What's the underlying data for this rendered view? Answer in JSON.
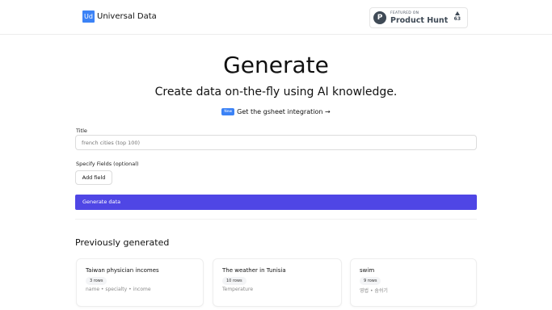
{
  "header": {
    "logo_mark": "Ud",
    "app_name": "Universal Data",
    "producthunt": {
      "featured_label": "FEATURED ON",
      "name": "Product Hunt",
      "votes": "63"
    }
  },
  "hero": {
    "title": "Generate",
    "subtitle": "Create data on-the-fly using AI knowledge.",
    "new_badge": "New",
    "gsheet_link": "Get the gsheet integration →"
  },
  "form": {
    "title_label": "Title",
    "title_placeholder": "french cities (top 100)",
    "fields_label": "Specify Fields (optional)",
    "add_field_label": "Add field",
    "generate_label": "Generate data"
  },
  "previous": {
    "heading": "Previously generated",
    "cards": [
      {
        "title": "Taiwan physician incomes",
        "rows": "3 rows",
        "fields": "name • specialty • income"
      },
      {
        "title": "The weather in Tunisia",
        "rows": "10 rows",
        "fields": "Temperature"
      },
      {
        "title": "swim",
        "rows": "9 rows",
        "fields": "영법 • 숨쉬기"
      }
    ]
  }
}
